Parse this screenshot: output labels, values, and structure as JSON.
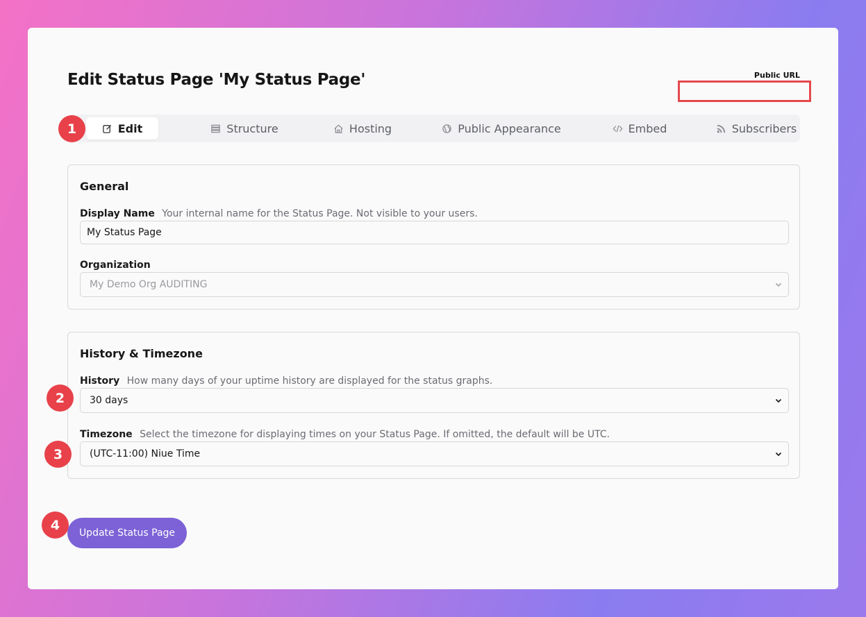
{
  "page": {
    "title": "Edit Status Page 'My Status Page'",
    "public_url_label": "Public URL",
    "public_url_value": ""
  },
  "tabs": [
    {
      "label": "Edit",
      "icon": "edit-icon",
      "active": true
    },
    {
      "label": "Structure",
      "icon": "structure-icon",
      "active": false
    },
    {
      "label": "Hosting",
      "icon": "home-icon",
      "active": false
    },
    {
      "label": "Public Appearance",
      "icon": "globe-icon",
      "active": false
    },
    {
      "label": "Embed",
      "icon": "code-icon",
      "active": false
    },
    {
      "label": "Subscribers",
      "icon": "rss-icon",
      "active": false
    }
  ],
  "general": {
    "title": "General",
    "display_name_label": "Display Name",
    "display_name_desc": "Your internal name for the Status Page. Not visible to your users.",
    "display_name_value": "My Status Page",
    "organization_label": "Organization",
    "organization_value": "My Demo Org AUDITING"
  },
  "history_tz": {
    "title": "History & Timezone",
    "history_label": "History",
    "history_desc": "How many days of your uptime history are displayed for the status graphs.",
    "history_value": "30 days",
    "timezone_label": "Timezone",
    "timezone_desc": "Select the timezone for displaying times on your Status Page. If omitted, the default will be UTC.",
    "timezone_value": "(UTC-11:00) Niue Time"
  },
  "actions": {
    "update_label": "Update Status Page"
  },
  "badges": [
    "1",
    "2",
    "3",
    "4"
  ],
  "colors": {
    "accent": "#7c62d6",
    "badge": "#e8414a",
    "highlight_border": "#e5484d"
  }
}
